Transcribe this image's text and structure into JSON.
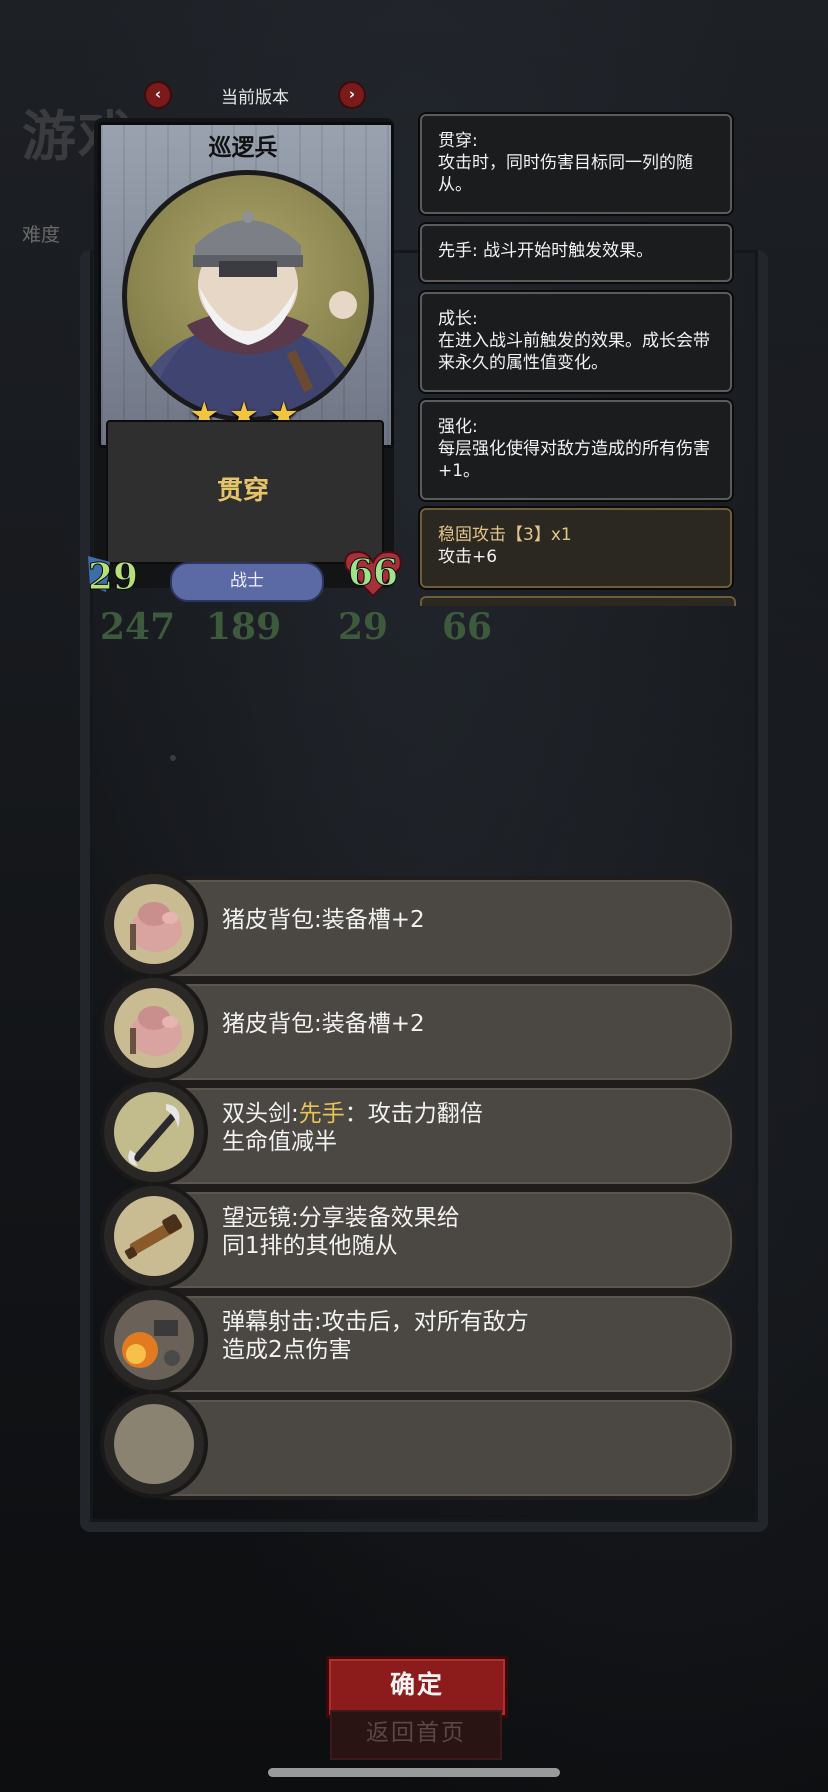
{
  "background": {
    "title": "游戏",
    "difficulty_label": "难度",
    "stats_left": [
      "247",
      "189"
    ],
    "stats_right": [
      "29",
      "66"
    ]
  },
  "version_nav": {
    "label": "当前版本",
    "prev_glyph": "‹",
    "next_glyph": "›"
  },
  "unit_card": {
    "name": "巡逻兵",
    "star_count": 3,
    "stars": [
      "★",
      "★",
      "★"
    ],
    "skill": "贯穿",
    "attack": "29",
    "health": "66",
    "class": "战士"
  },
  "keywords": [
    {
      "title": "贯穿:",
      "desc": "攻击时，同时伤害目标同一列的随从。"
    },
    {
      "title": "先手:",
      "desc": "战斗开始时触发效果。"
    },
    {
      "title": "成长:",
      "desc": "在进入战斗前触发的效果。成长会带来永久的属性值变化。"
    },
    {
      "title": "强化:",
      "desc": "每层强化使得对敌方造成的所有伤害+1。"
    },
    {
      "title": "稳固攻击【3】x1",
      "desc": "攻击+6"
    }
  ],
  "items": [
    {
      "icon": "pig-backpack-icon",
      "line1_name": "猪皮背包",
      "line1_sep": ":",
      "line1_accent": "",
      "line1_rest": "装备槽+2",
      "line2": ""
    },
    {
      "icon": "pig-backpack-icon",
      "line1_name": "猪皮背包",
      "line1_sep": ":",
      "line1_accent": "",
      "line1_rest": "装备槽+2",
      "line2": ""
    },
    {
      "icon": "double-sword-icon",
      "line1_name": "双头剑",
      "line1_sep": ":",
      "line1_accent": "先手",
      "line1_rest": "：攻击力翻倍",
      "line2": "生命值减半"
    },
    {
      "icon": "telescope-icon",
      "line1_name": "望远镜",
      "line1_sep": ":",
      "line1_accent": "",
      "line1_rest": "分享装备效果给",
      "line2": "同1排的其他随从"
    },
    {
      "icon": "barrage-icon",
      "line1_name": "弹幕射击",
      "line1_sep": ":",
      "line1_accent": "",
      "line1_rest": "攻击后，对所有敌方",
      "line2": "造成2点伤害"
    }
  ],
  "buttons": {
    "confirm": "确定",
    "home": "返回首页"
  },
  "colors": {
    "accent_gold": "#e8c35a",
    "attack_green": "#b7e07a",
    "health_green": "#9fe38a",
    "confirm_red": "#8c1b1b",
    "class_blue": "#5b6aa4"
  }
}
